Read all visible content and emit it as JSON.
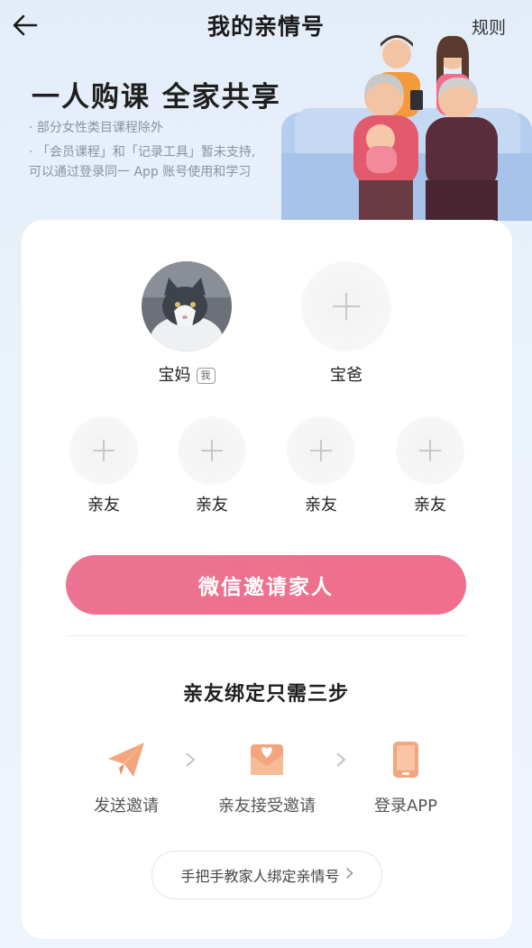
{
  "header": {
    "title": "我的亲情号",
    "rules_label": "规则"
  },
  "banner": {
    "headline": "一人购课 全家共享",
    "notes": [
      "· 部分女性类目课程除外",
      "· 「会员课程」和「记录工具」暂未支持,",
      "可以通过登录同一 App 账号使用和学习"
    ]
  },
  "members": {
    "primary": [
      {
        "label": "宝妈",
        "badge": "我"
      },
      {
        "label": "宝爸"
      }
    ],
    "friends": [
      {
        "label": "亲友"
      },
      {
        "label": "亲友"
      },
      {
        "label": "亲友"
      },
      {
        "label": "亲友"
      }
    ]
  },
  "invite_button": "微信邀请家人",
  "steps": {
    "title": "亲友绑定只需三步",
    "items": [
      {
        "label": "发送邀请",
        "icon": "paper-plane-icon"
      },
      {
        "label": "亲友接受邀请",
        "icon": "heart-envelope-icon"
      },
      {
        "label": "登录APP",
        "icon": "phone-icon"
      }
    ]
  },
  "tutorial_button": "手把手教家人绑定亲情号",
  "colors": {
    "accent": "#ee7290",
    "icon_orange": "#f3a67e",
    "background": "#e6eefa"
  }
}
